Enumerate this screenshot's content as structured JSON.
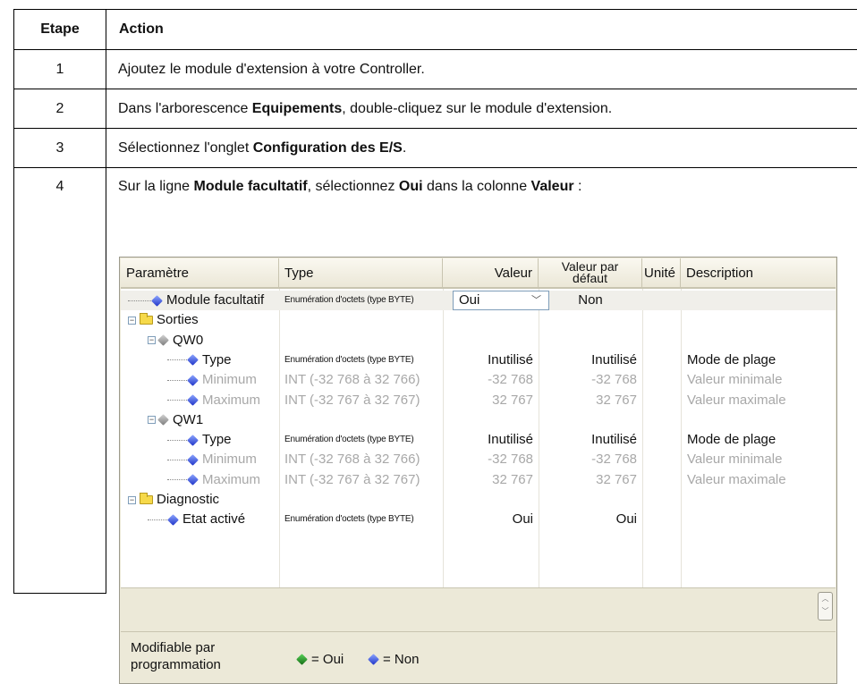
{
  "table": {
    "headers": [
      "Etape",
      "Action"
    ],
    "rows": [
      {
        "step": "1",
        "parts": [
          {
            "t": "Ajoutez le module d'extension à votre Controller.",
            "b": false
          }
        ]
      },
      {
        "step": "2",
        "parts": [
          {
            "t": "Dans l'arborescence ",
            "b": false
          },
          {
            "t": "Equipements",
            "b": true
          },
          {
            "t": ", double-cliquez sur le module d'extension.",
            "b": false
          }
        ]
      },
      {
        "step": "3",
        "parts": [
          {
            "t": "Sélectionnez l'onglet ",
            "b": false
          },
          {
            "t": "Configuration des E/S",
            "b": true
          },
          {
            "t": ".",
            "b": false
          }
        ]
      },
      {
        "step": "4",
        "parts": [
          {
            "t": "Sur la ligne ",
            "b": false
          },
          {
            "t": "Module facultatif",
            "b": true
          },
          {
            "t": ", sélectionnez ",
            "b": false
          },
          {
            "t": "Oui",
            "b": true
          },
          {
            "t": " dans la colonne ",
            "b": false
          },
          {
            "t": "Valeur",
            "b": true
          },
          {
            "t": " :",
            "b": false
          }
        ]
      }
    ]
  },
  "config": {
    "columns": {
      "parametre": "Paramètre",
      "type": "Type",
      "valeur": "Valeur",
      "defaut_1": "Valeur par",
      "defaut_2": "défaut",
      "unite": "Unité",
      "description": "Description"
    },
    "rows": [
      {
        "name": "Module facultatif",
        "icon": "blue",
        "level": 0,
        "kind": "leaf",
        "type": "Enumération d'octets (type BYTE)",
        "type_small": true,
        "valeur": "Oui",
        "dropdown": true,
        "defaut": "Non",
        "desc": "",
        "grey": false,
        "hl": true
      },
      {
        "name": "Sorties",
        "icon": "folder",
        "level": 0,
        "kind": "folder",
        "type": "",
        "valeur": "",
        "defaut": "",
        "desc": "",
        "grey": false
      },
      {
        "name": "QW0",
        "icon": "grey",
        "level": 1,
        "kind": "node",
        "type": "",
        "valeur": "",
        "defaut": "",
        "desc": "",
        "grey": false
      },
      {
        "name": "Type",
        "icon": "blue",
        "level": 2,
        "kind": "leaf",
        "type": "Enumération d'octets (type BYTE)",
        "type_small": true,
        "valeur": "Inutilisé",
        "defaut": "Inutilisé",
        "desc": "Mode de plage",
        "grey": false
      },
      {
        "name": "Minimum",
        "icon": "blue",
        "level": 2,
        "kind": "leaf",
        "type": "INT (-32 768 à 32 766)",
        "valeur": "-32 768",
        "defaut": "-32 768",
        "desc": "Valeur minimale",
        "grey": true
      },
      {
        "name": "Maximum",
        "icon": "blue",
        "level": 2,
        "kind": "leaf",
        "type": "INT (-32 767 à 32 767)",
        "valeur": "32 767",
        "defaut": "32 767",
        "desc": "Valeur maximale",
        "grey": true
      },
      {
        "name": "QW1",
        "icon": "grey",
        "level": 1,
        "kind": "node",
        "type": "",
        "valeur": "",
        "defaut": "",
        "desc": "",
        "grey": false
      },
      {
        "name": "Type",
        "icon": "blue",
        "level": 2,
        "kind": "leaf",
        "type": "Enumération d'octets (type BYTE)",
        "type_small": true,
        "valeur": "Inutilisé",
        "defaut": "Inutilisé",
        "desc": "Mode de plage",
        "grey": false
      },
      {
        "name": "Minimum",
        "icon": "blue",
        "level": 2,
        "kind": "leaf",
        "type": "INT (-32 768 à 32 766)",
        "valeur": "-32 768",
        "defaut": "-32 768",
        "desc": "Valeur minimale",
        "grey": true
      },
      {
        "name": "Maximum",
        "icon": "blue",
        "level": 2,
        "kind": "leaf",
        "type": "INT (-32 767 à 32 767)",
        "valeur": "32 767",
        "defaut": "32 767",
        "desc": "Valeur maximale",
        "grey": true
      },
      {
        "name": "Diagnostic",
        "icon": "folder",
        "level": 0,
        "kind": "folder",
        "type": "",
        "valeur": "",
        "defaut": "",
        "desc": "",
        "grey": false
      },
      {
        "name": "Etat activé",
        "icon": "blue",
        "level": 1,
        "kind": "leaf",
        "type": "Enumération d'octets (type BYTE)",
        "type_small": true,
        "valeur": "Oui",
        "defaut": "Oui",
        "desc": "",
        "grey": false
      }
    ],
    "legend": {
      "label": "Modifiable par programmation",
      "oui": "= Oui",
      "non": "= Non"
    }
  },
  "colors": {
    "blue_param": "#2a44d8",
    "green_param": "#1e8a1e",
    "grey_text": "#a8a8a8"
  }
}
